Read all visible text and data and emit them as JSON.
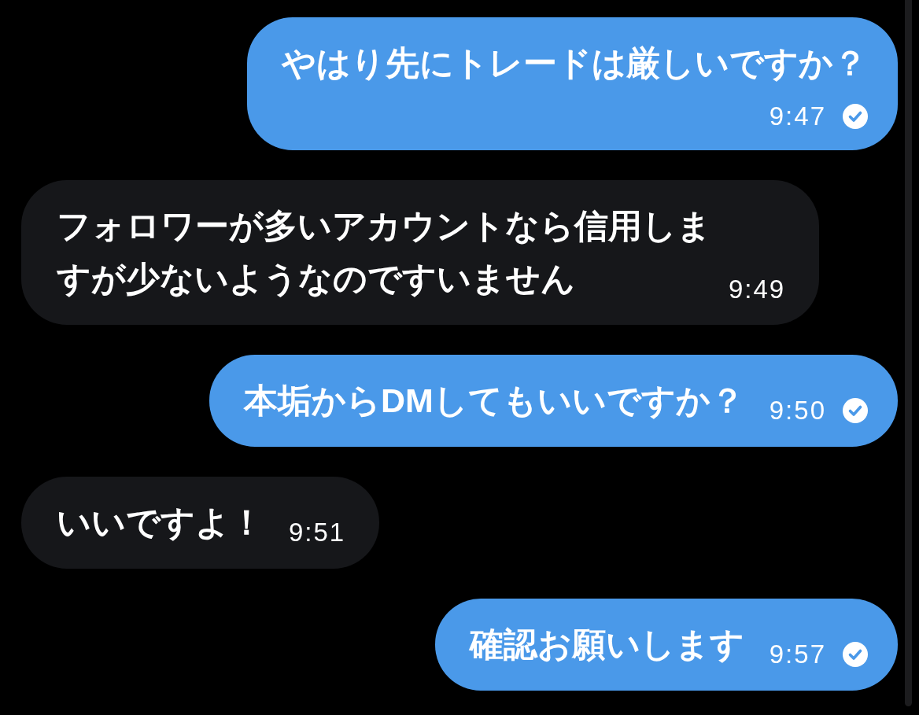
{
  "messages": [
    {
      "kind": "outgoing",
      "text": "やはり先にトレードは厳しいですか？",
      "time": "9:47"
    },
    {
      "kind": "incoming",
      "text": "フォロワーが多いアカウントなら信用しますが少ないようなのですいません",
      "time": "9:49"
    },
    {
      "kind": "outgoing",
      "text": "本垢からDMしてもいいですか？",
      "time": "9:50"
    },
    {
      "kind": "incoming",
      "text": "いいですよ！",
      "time": "9:51"
    },
    {
      "kind": "outgoing",
      "text": "確認お願いします",
      "time": "9:57"
    }
  ]
}
